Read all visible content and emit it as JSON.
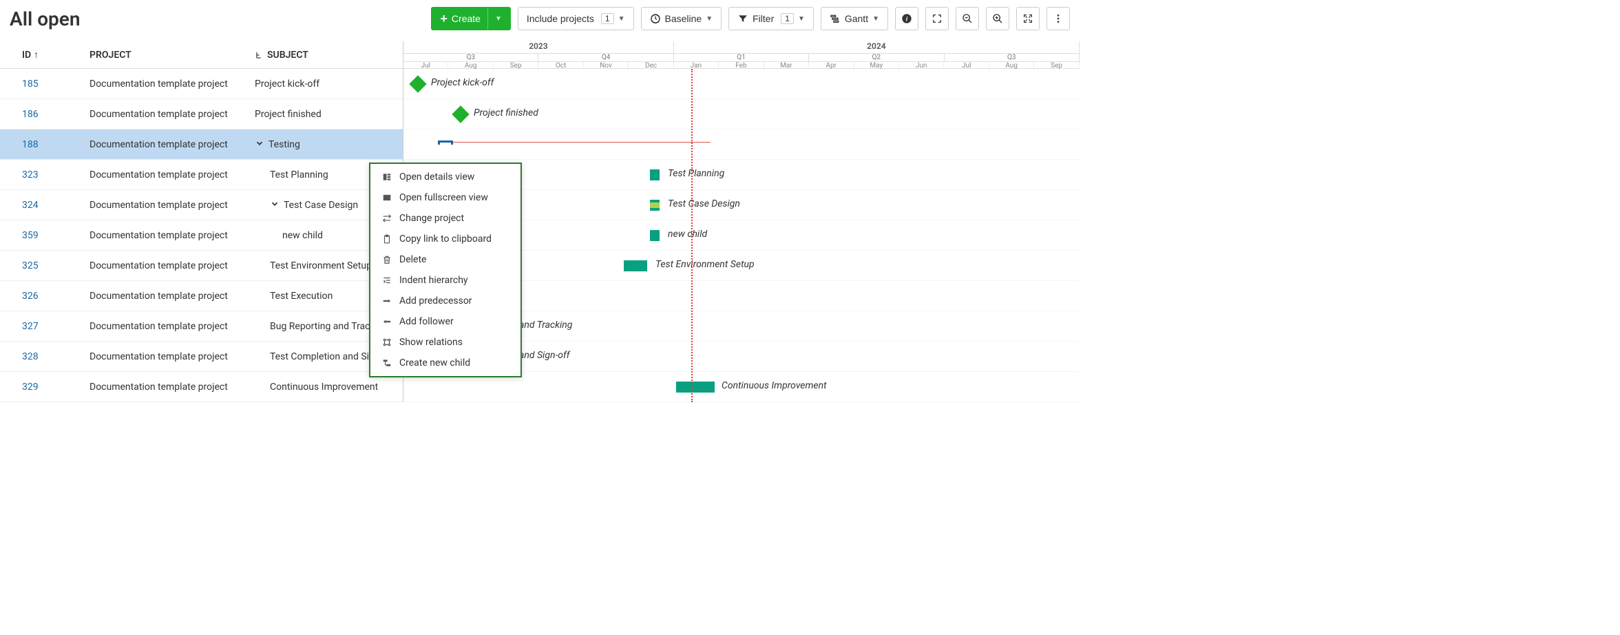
{
  "page_title": "All open",
  "toolbar": {
    "create": "Create",
    "include_projects": "Include projects",
    "include_projects_count": "1",
    "baseline": "Baseline",
    "filter": "Filter",
    "filter_count": "1",
    "gantt": "Gantt"
  },
  "columns": {
    "id": "ID",
    "project": "PROJECT",
    "subject": "SUBJECT"
  },
  "project_name": "Documentation template project",
  "rows": [
    {
      "id": "185",
      "subject": "Project kick-off",
      "indent": 0,
      "expand": false
    },
    {
      "id": "186",
      "subject": "Project finished",
      "indent": 0,
      "expand": false
    },
    {
      "id": "188",
      "subject": "Testing",
      "indent": 0,
      "expand": true,
      "selected": true
    },
    {
      "id": "323",
      "subject": "Test Planning",
      "indent": 1,
      "expand": false
    },
    {
      "id": "324",
      "subject": "Test Case Design",
      "indent": 1,
      "expand": true
    },
    {
      "id": "359",
      "subject": "new child",
      "indent": 2,
      "expand": false
    },
    {
      "id": "325",
      "subject": "Test Environment Setup",
      "indent": 1,
      "expand": false
    },
    {
      "id": "326",
      "subject": "Test Execution",
      "indent": 1,
      "expand": false
    },
    {
      "id": "327",
      "subject": "Bug Reporting and Tracking",
      "indent": 1,
      "expand": false
    },
    {
      "id": "328",
      "subject": "Test Completion and Sign-off",
      "indent": 1,
      "expand": false
    },
    {
      "id": "329",
      "subject": "Continuous Improvement",
      "indent": 1,
      "expand": false
    }
  ],
  "timeline": {
    "years": [
      "2023",
      "2024"
    ],
    "quarters": [
      "Q3",
      "Q4",
      "Q1",
      "Q2",
      "Q3"
    ],
    "months": [
      "Jul",
      "Aug",
      "Sep",
      "Oct",
      "Nov",
      "Dec",
      "Jan",
      "Feb",
      "Mar",
      "Apr",
      "May",
      "Jun",
      "Jul",
      "Aug",
      "Sep"
    ]
  },
  "gantt_labels": {
    "kickoff": "Project kick-off",
    "finished": "Project finished",
    "planning": "Test Planning",
    "design": "Test Case Design",
    "newchild": "new child",
    "env": "Test Environment Setup",
    "bug": "Bug Reporting and Tracking",
    "completion": "Test Completion and Sign-off",
    "continuous": "Continuous Improvement"
  },
  "context_menu": [
    {
      "icon": "details",
      "label": "Open details view"
    },
    {
      "icon": "fullscreen",
      "label": "Open fullscreen view"
    },
    {
      "icon": "change",
      "label": "Change project"
    },
    {
      "icon": "clipboard",
      "label": "Copy link to clipboard"
    },
    {
      "icon": "delete",
      "label": "Delete"
    },
    {
      "icon": "indent",
      "label": "Indent hierarchy"
    },
    {
      "icon": "predecessor",
      "label": "Add predecessor"
    },
    {
      "icon": "follower",
      "label": "Add follower"
    },
    {
      "icon": "relations",
      "label": "Show relations"
    },
    {
      "icon": "child",
      "label": "Create new child"
    }
  ]
}
